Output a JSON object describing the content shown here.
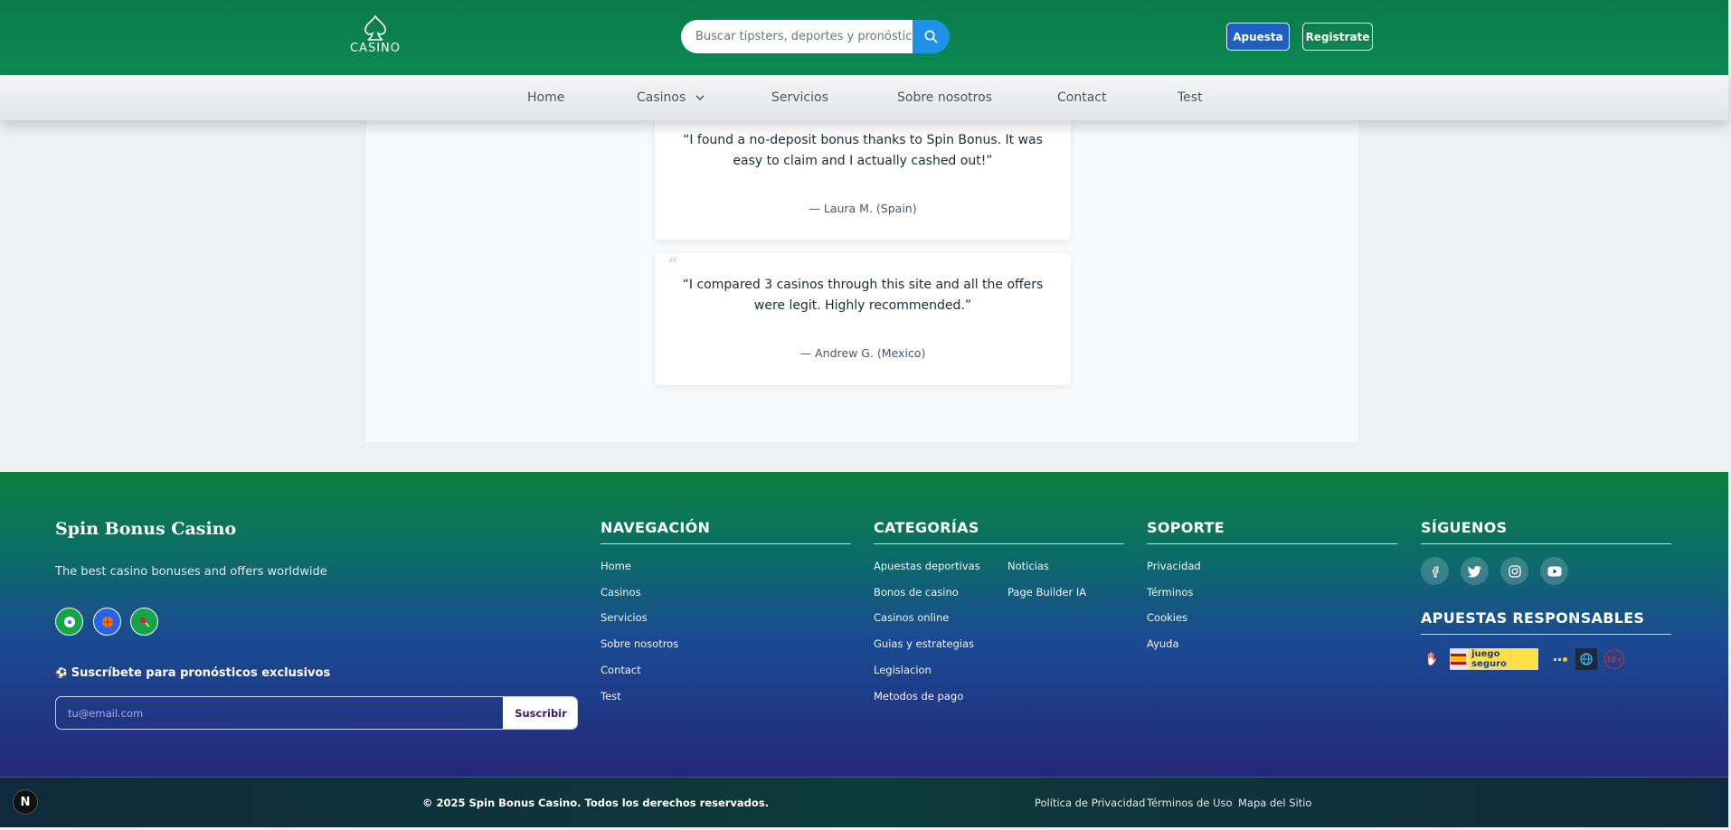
{
  "header": {
    "logo_text": "CASINO",
    "search_placeholder": "Buscar tipsters, deportes y pronósticos...",
    "apuesta_label": "Apuesta",
    "registrate_label": "Registrate",
    "brand_color": "#0b7a48"
  },
  "nav": {
    "items": [
      "Home",
      "Casinos",
      "Servicios",
      "Sobre nosotros",
      "Contact",
      "Test"
    ]
  },
  "testimonials": [
    {
      "quote": "“I found a no-deposit bonus thanks to Spin Bonus. It was easy to claim and I actually cashed out!”",
      "author": "— Laura M. (Spain)"
    },
    {
      "quote": "“I compared 3 casinos through this site and all the offers were legit. Highly recommended.”",
      "author": "— Andrew G. (Mexico)"
    }
  ],
  "footer": {
    "brand": "Spin Bonus Casino",
    "tagline": "The best casino bonuses and offers worldwide",
    "subscribe_label": "Suscríbete para pronósticos exclusivos",
    "email_placeholder": "tu@email.com",
    "subscribe_button": "Suscribir",
    "navegacion": {
      "title": "NAVEGACIÓN",
      "links": [
        "Home",
        "Casinos",
        "Servicios",
        "Sobre nosotros",
        "Contact",
        "Test"
      ]
    },
    "categorias": {
      "title": "CATEGORÍAS",
      "links_col1": [
        "Apuestas deportivas",
        "Bonos de casino",
        "Casinos online",
        "Guias y estrategias",
        "Legislacion",
        "Metodos de pago"
      ],
      "links_col2": [
        "Noticias",
        "Page Builder IA"
      ]
    },
    "soporte": {
      "title": "SOPORTE",
      "links": [
        "Privacidad",
        "Términos",
        "Cookies",
        "Ayuda"
      ]
    },
    "siguenos": {
      "title": "SÍGUENOS",
      "icons": [
        "facebook-icon",
        "twitter-icon",
        "instagram-icon",
        "youtube-icon"
      ]
    },
    "responsables": {
      "title": "APUESTAS RESPONSABLES",
      "badge_text": "juego seguro",
      "age_text": "18+"
    }
  },
  "bottom": {
    "copyright": "© 2025 Spin Bonus Casino. Todos los derechos reservados.",
    "links": [
      "Política de Privacidad",
      "Términos de Uso",
      "Mapa del Sitio"
    ],
    "dev_badge": "N"
  }
}
